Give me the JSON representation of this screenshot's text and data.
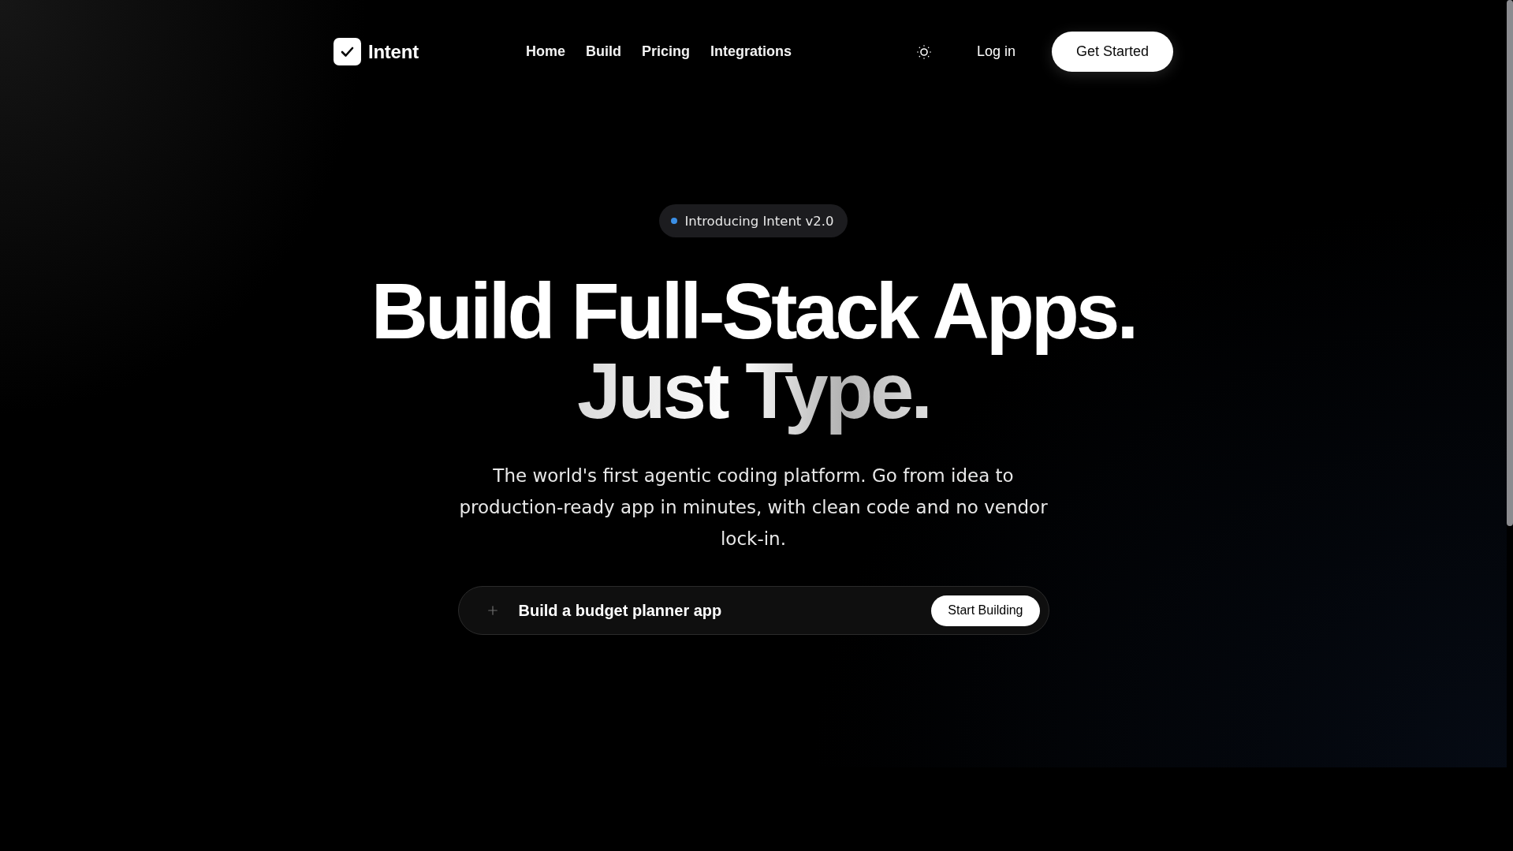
{
  "nav": {
    "brand": "Intent",
    "links": [
      "Home",
      "Build",
      "Pricing",
      "Integrations"
    ],
    "login": "Log in",
    "cta": "Get Started"
  },
  "hero": {
    "badge": "Introducing Intent v2.0",
    "headline": {
      "line_1": "Build Full-Stack Apps.",
      "line_2": "Just Type."
    },
    "description": "The world's first agentic coding platform. Go from idea to production-ready app in minutes, with clean code and no vendor lock-in.",
    "prompt": {
      "value": "Build a budget planner app",
      "button": "Start Building"
    }
  }
}
